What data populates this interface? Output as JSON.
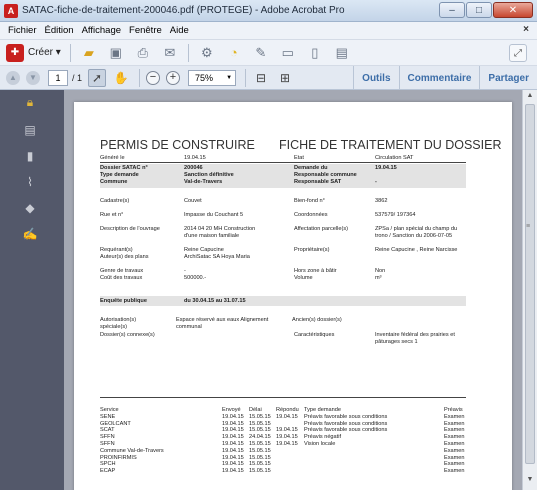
{
  "window": {
    "title": "SATAC-fiche-de-traitement-200046.pdf (PROTEGE) - Adobe Acrobat Pro",
    "app_icon_glyph": "A",
    "controls": {
      "minimize": "–",
      "maximize": "□",
      "close": "✕"
    }
  },
  "menu": {
    "items": [
      "Fichier",
      "Édition",
      "Affichage",
      "Fenêtre",
      "Aide"
    ],
    "close_glyph": "×"
  },
  "toolbar": {
    "create_label": "Créer ▾",
    "icons": [
      "folder-open-icon",
      "save-icon",
      "print-icon",
      "email-icon",
      "settings-icon",
      "comment-icon",
      "combine-icon",
      "page-icon",
      "page-export-icon",
      "pages-icon"
    ],
    "page_current": "1",
    "page_total": "/ 1",
    "zoom_value": "75%",
    "right_tabs": {
      "tools": "Outils",
      "comment": "Commentaire",
      "share": "Partager"
    }
  },
  "document": {
    "title_left": "PERMIS DE CONSTRUIRE",
    "title_right": "FICHE DE TRAITEMENT DU DOSSIER",
    "meta": {
      "generated_label": "Généré le",
      "generated_value": "19.04.15",
      "state_label": "Etat",
      "state_value": "Circulation SAT"
    },
    "dossier": {
      "left_labels": [
        "Dossier SATAC n°",
        "Type demande",
        "Commune"
      ],
      "left_values": [
        "200046",
        "Sanction définitive",
        "Val-de-Travers"
      ],
      "right_labels": [
        "Demande du",
        "Responsable commune",
        "Responsable SAT"
      ],
      "right_values": [
        "19.04.15",
        "",
        "-"
      ]
    },
    "details": [
      {
        "l1": "Cadastre(s)",
        "v1": "Couvet",
        "l2": "Bien-fond n°",
        "v2": "3862"
      },
      {
        "l1": "Rue et n°",
        "v1": "Impasse du Couchant 5",
        "l2": "Coordonnées",
        "v2": "537579/ 197364"
      },
      {
        "l1": "Description de l'ouvrage",
        "v1": "2014 04 20 MH Construction",
        "v1b": "d'une maison familiale",
        "l2": "Affectation parcelle(s)",
        "v2": "ZPSa / plan spécial du champ du",
        "v2b": "trono / Sanction du 2006-07-05"
      },
      {
        "l1": "Requérant(s)",
        "l1b": "Auteur(s) des plans",
        "v1": "Reine Capucine",
        "v1b": "ArchiSatac SA Hoya Maria",
        "l2": "Propriétaire(s)",
        "v2": "Reine Capucine , Reine Narcisse"
      },
      {
        "l1": "Genre de travaux",
        "l1b": "Coût des travaux",
        "v1": "-",
        "v1b": "500000.-",
        "l2": "Hors zone à bâtir",
        "l2b": "Volume",
        "v2": "Non",
        "v2b": "m³"
      }
    ],
    "enquete": {
      "label": "Enquête publique",
      "value": "du 30.04.15 au 31.07.15"
    },
    "autorisation": {
      "l1": "Autorisation(s)",
      "l1b": "spéciale(s)",
      "v1": "Espace réservé aux eaux Alignement",
      "v1b": "communal",
      "l2": "Ancien(s) dossier(s)",
      "l3": "Dossier(s) connexe(s)",
      "l4": "Caractéristiques",
      "v4": "Inventaire fédéral des prairies et",
      "v4b": "pâturages secs 1"
    },
    "services": {
      "headers": {
        "service": "Service",
        "envoye": "Envoyé",
        "delai": "Délai",
        "repondu": "Répondu",
        "type": "Type demande",
        "preavis": "Préavis"
      },
      "rows": [
        {
          "service": "SENE",
          "envoye": "19.04.15",
          "delai": "15.05.15",
          "repondu": "19.04.15",
          "type": "Préavis favorable sous conditions",
          "preavis": "Examen"
        },
        {
          "service": "GEOLCANT",
          "envoye": "19.04.15",
          "delai": "15.05.15",
          "repondu": "",
          "type": "Préavis favorable sous conditions",
          "preavis": "Examen"
        },
        {
          "service": "SCAT",
          "envoye": "19.04.15",
          "delai": "15.05.15",
          "repondu": "19.04.15",
          "type": "Préavis favorable sous conditions",
          "preavis": "Examen"
        },
        {
          "service": "SFFN",
          "envoye": "19.04.15",
          "delai": "24.04.15",
          "repondu": "19.04.15",
          "type": "Préavis négatif",
          "preavis": "Examen"
        },
        {
          "service": "SFFN",
          "envoye": "19.04.15",
          "delai": "15.05.15",
          "repondu": "19.04.15",
          "type": "Vision locale",
          "preavis": "Examen"
        },
        {
          "service": "Commune Val-de-Travers",
          "envoye": "19.04.15",
          "delai": "15.05.15",
          "repondu": "",
          "type": "",
          "preavis": "Examen"
        },
        {
          "service": "PROINFIRMIS",
          "envoye": "19.04.15",
          "delai": "15.05.15",
          "repondu": "",
          "type": "",
          "preavis": "Examen"
        },
        {
          "service": "SPCH",
          "envoye": "19.04.15",
          "delai": "15.05.15",
          "repondu": "",
          "type": "",
          "preavis": "Examen"
        },
        {
          "service": "ECAP",
          "envoye": "19.04.15",
          "delai": "15.05.15",
          "repondu": "",
          "type": "",
          "preavis": "Examen"
        }
      ]
    }
  },
  "left_panel_icons": [
    "lock-icon",
    "pages-panel-icon",
    "bookmark-icon",
    "attachment-icon",
    "layers-icon",
    "signature-icon"
  ],
  "colors": {
    "acrobat_red": "#c8201e",
    "pane_label_blue": "#3d6ea8",
    "left_panel": "#53586a",
    "doc_background": "#a4a8b3"
  }
}
